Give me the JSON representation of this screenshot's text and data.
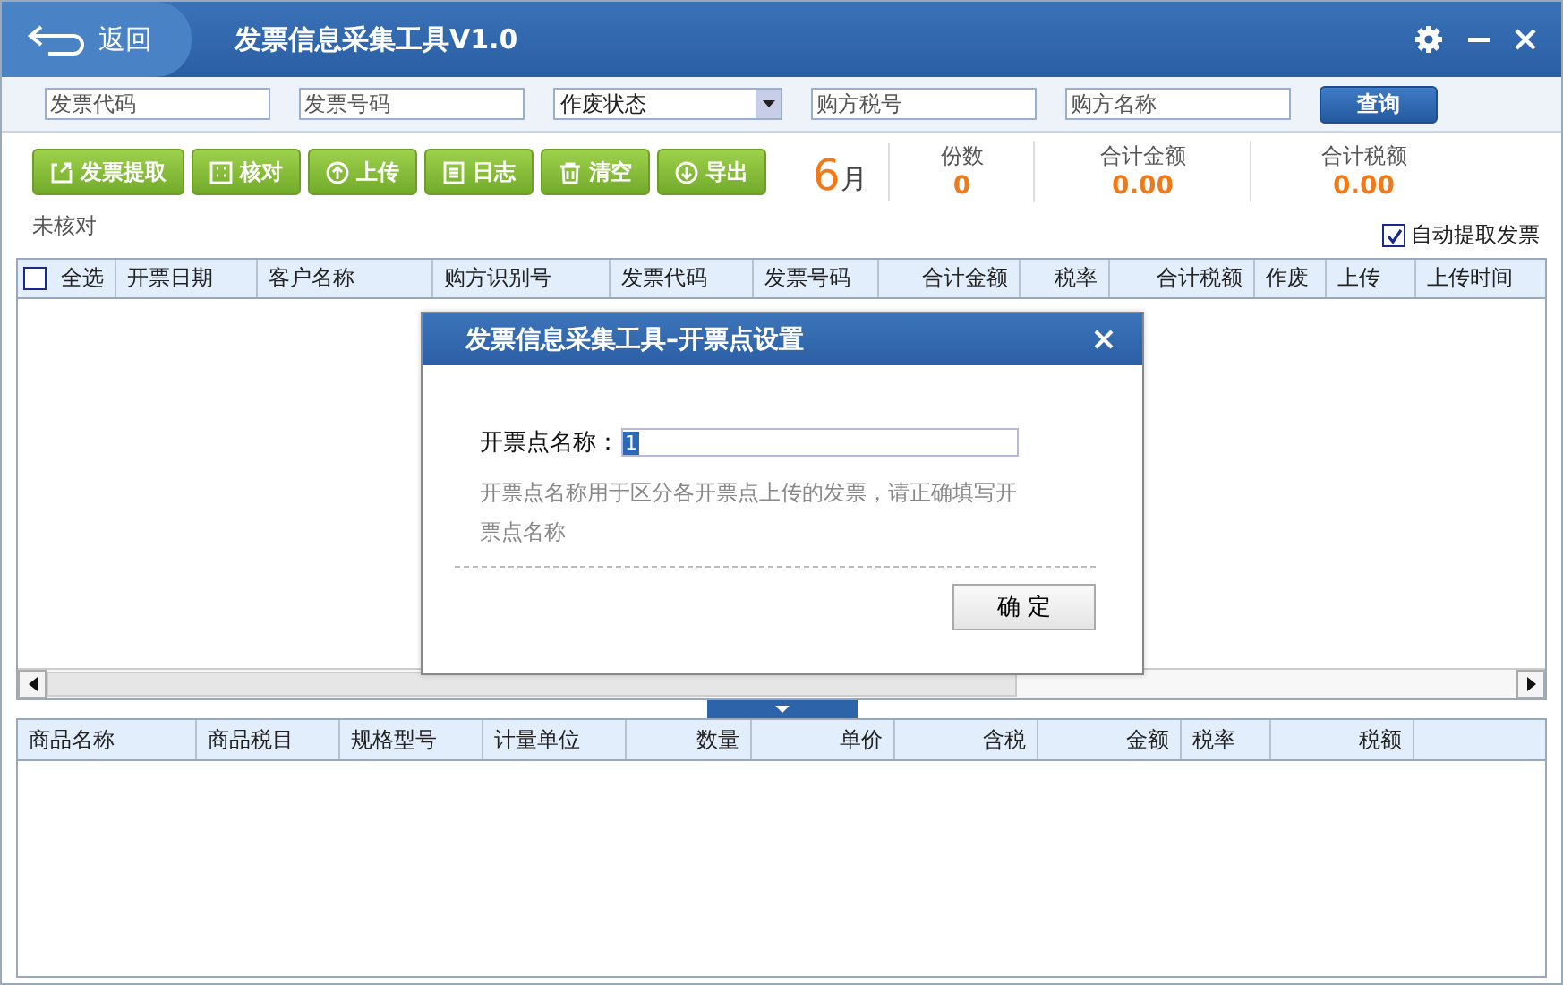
{
  "title_bar": {
    "back": "返回",
    "title": "发票信息采集工具V1.0"
  },
  "filters": {
    "fields": [
      {
        "placeholder": "发票代码"
      },
      {
        "placeholder": "发票号码"
      }
    ],
    "status_select": "作废状态",
    "fields2": [
      {
        "placeholder": "购方税号"
      },
      {
        "placeholder": "购方名称"
      }
    ],
    "query": "查询"
  },
  "toolbar": [
    {
      "label": "发票提取",
      "kind": "extract"
    },
    {
      "label": "核对",
      "kind": "check"
    },
    {
      "label": "上传",
      "kind": "upload"
    },
    {
      "label": "日志",
      "kind": "log"
    },
    {
      "label": "清空",
      "kind": "clear"
    },
    {
      "label": "导出",
      "kind": "export"
    }
  ],
  "month": {
    "number": "6",
    "unit": "月"
  },
  "stats": [
    {
      "label": "份数",
      "value": "0"
    },
    {
      "label": "合计金额",
      "value": "0.00"
    },
    {
      "label": "合计税额",
      "value": "0.00"
    }
  ],
  "check_status": "未核对",
  "auto_extract": {
    "label": "自动提取发票",
    "checked": true
  },
  "invoice_table": {
    "select_all": {
      "label": "全选",
      "checked": false
    },
    "columns": [
      "开票日期",
      "客户名称",
      "购方识别号",
      "发票代码",
      "发票号码",
      "合计金额",
      "税率",
      "合计税额",
      "作废",
      "上传",
      "上传时间"
    ]
  },
  "items_table": {
    "columns": [
      "商品名称",
      "商品税目",
      "规格型号",
      "计量单位",
      "数量",
      "单价",
      "含税",
      "金额",
      "税率",
      "税额"
    ]
  },
  "dialog": {
    "title": "发票信息采集工具–开票点设置",
    "label": "开票点名称：",
    "value": "1",
    "hint": "开票点名称用于区分各开票点上传的发票，请正确填写开票点名称",
    "ok": "确 定"
  }
}
